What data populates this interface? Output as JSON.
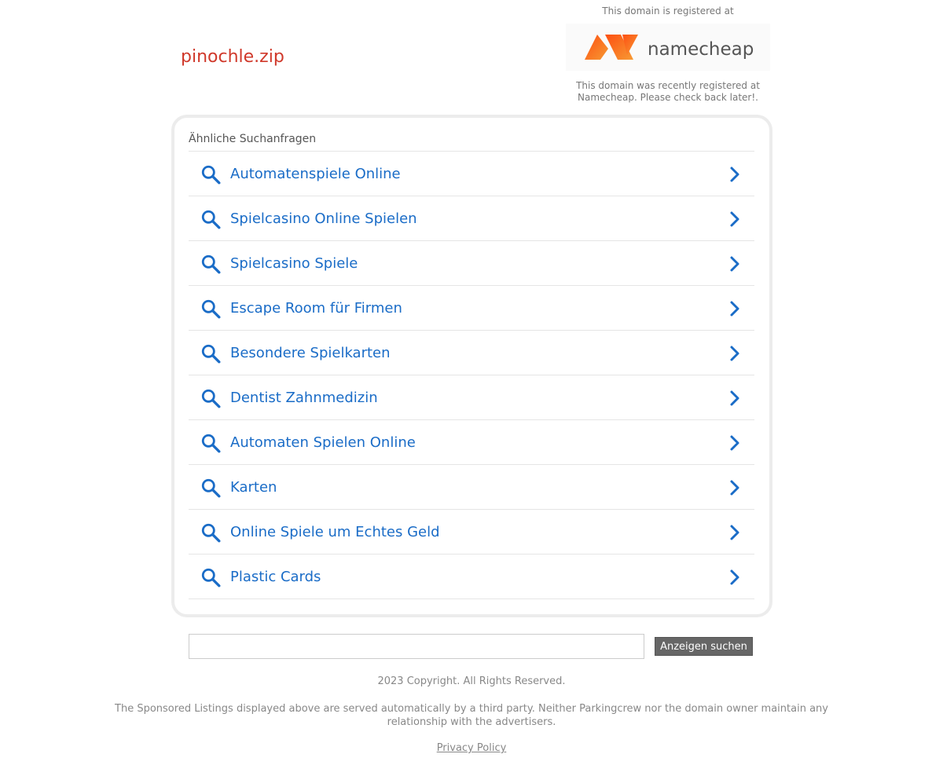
{
  "domain": "pinochle.zip",
  "registrar": {
    "top_text": "This domain is registered at",
    "logo_text": "namecheap",
    "message_line1": "This domain was recently registered at",
    "message_line2": "Namecheap. Please check back later!."
  },
  "related": {
    "title": "Ähnliche Suchanfragen",
    "items": [
      {
        "label": "Automatenspiele Online"
      },
      {
        "label": "Spielcasino Online Spielen"
      },
      {
        "label": "Spielcasino Spiele"
      },
      {
        "label": "Escape Room für Firmen"
      },
      {
        "label": "Besondere Spielkarten"
      },
      {
        "label": "Dentist Zahnmedizin"
      },
      {
        "label": "Automaten Spielen Online"
      },
      {
        "label": "Karten"
      },
      {
        "label": "Online Spiele um Echtes Geld"
      },
      {
        "label": "Plastic Cards"
      }
    ]
  },
  "search": {
    "value": "",
    "button_label": "Anzeigen suchen"
  },
  "footer": {
    "copyright": "2023 Copyright. All Rights Reserved.",
    "disclaimer": "The Sponsored Listings displayed above are served automatically by a third party. Neither Parkingcrew nor the domain owner maintain any relationship with the advertisers.",
    "privacy": "Privacy Policy"
  },
  "colors": {
    "domain": "#d0392b",
    "link": "#1a6cc7",
    "namecheap_orange": "#f15a29"
  },
  "icons": {
    "item_left": "search-icon",
    "item_right": "chevron-right-icon"
  }
}
